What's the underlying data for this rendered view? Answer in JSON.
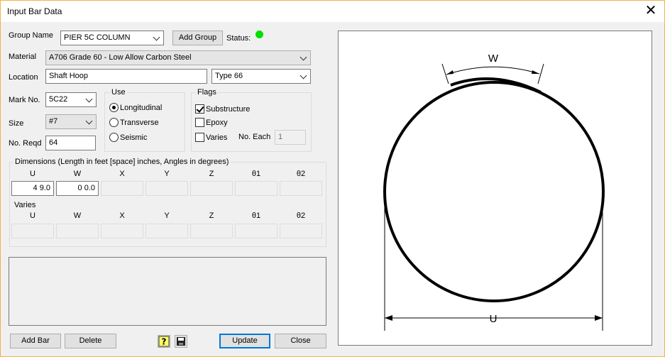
{
  "window": {
    "title": "Input Bar Data"
  },
  "group_name": {
    "label": "Group Name",
    "value": "PIER 5C COLUMN",
    "add_button": "Add Group",
    "status_label": "Status:",
    "status_color": "#00e000"
  },
  "material": {
    "label": "Material",
    "value": "A706 Grade 60 - Low Allow Carbon Steel"
  },
  "location": {
    "label": "Location",
    "value": "Shaft Hoop",
    "type_value": "Type 66"
  },
  "mark": {
    "label": "Mark No.",
    "value": "5C22"
  },
  "size": {
    "label": "Size",
    "value": "#7"
  },
  "reqd": {
    "label": "No. Reqd",
    "value": "64"
  },
  "use": {
    "title": "Use",
    "options": [
      "Longitudinal",
      "Transverse",
      "Seismic"
    ],
    "selected": "Longitudinal"
  },
  "flags": {
    "title": "Flags",
    "substructure": "Substructure",
    "epoxy": "Epoxy",
    "varies": "Varies",
    "no_each_label": "No. Each",
    "no_each_value": "1"
  },
  "dimensions": {
    "title": "Dimensions (Length in feet [space] inches, Angles in degrees)",
    "headers": [
      "U",
      "W",
      "X",
      "Y",
      "Z",
      "θ1",
      "θ2"
    ],
    "values": [
      "4  9.0",
      "0  0.0",
      "",
      "",
      "",
      "",
      ""
    ],
    "varies_title": "Varies"
  },
  "buttons": {
    "add_bar": "Add Bar",
    "delete": "Delete",
    "update": "Update",
    "close": "Close"
  },
  "icons": {
    "help": "help-icon",
    "save": "save-icon"
  },
  "diagram": {
    "label_w": "W",
    "label_u": "U"
  }
}
